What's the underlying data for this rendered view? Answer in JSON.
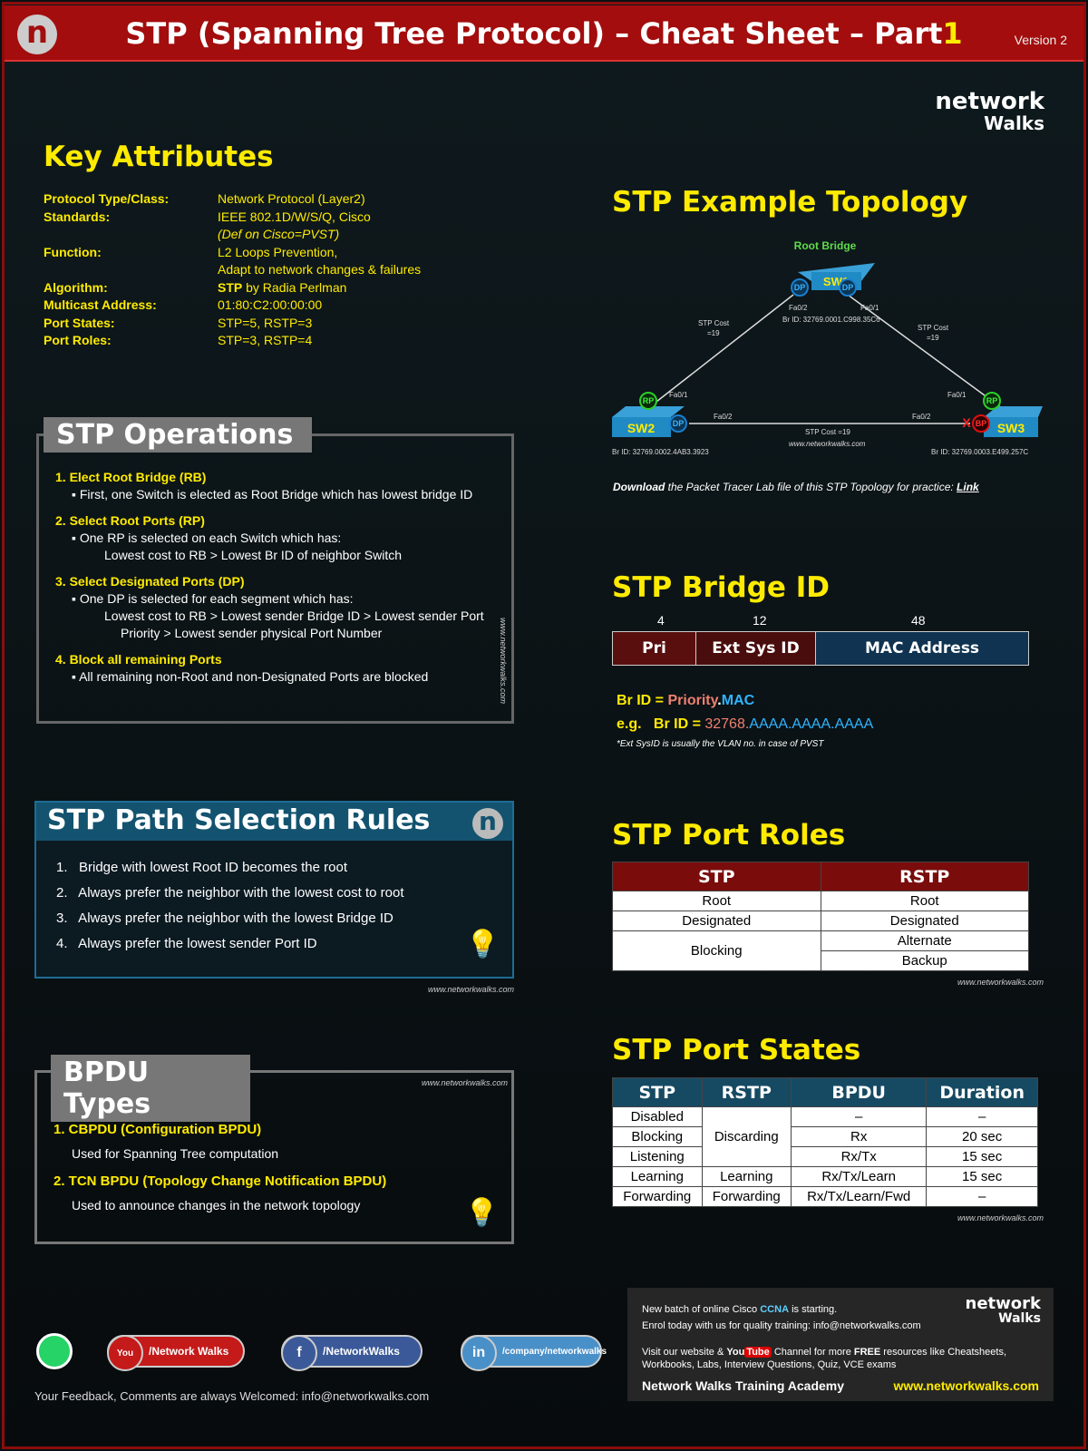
{
  "header": {
    "title": "STP (Spanning Tree Protocol) – Cheat Sheet – Part",
    "part": "1",
    "version": "Version 2",
    "logo": "n"
  },
  "brand": {
    "line1": "network",
    "line2": "Walks"
  },
  "key_attributes": {
    "title": "Key Attributes",
    "rows": [
      {
        "k": "Protocol Type/Class:",
        "v": "Network Protocol (Layer2)"
      },
      {
        "k": "Standards:",
        "v": "IEEE 802.1D/W/S/Q, Cisco"
      },
      {
        "k": "",
        "v": "(Def on Cisco=PVST)"
      },
      {
        "k": "Function:",
        "v": "L2 Loops Prevention,"
      },
      {
        "k": "",
        "v": "Adapt to network changes & failures"
      },
      {
        "k": "Algorithm:",
        "v_bold": "STP",
        "v": " by Radia Perlman"
      },
      {
        "k": "Multicast Address:",
        "v": "01:80:C2:00:00:00"
      },
      {
        "k": "Port States:",
        "v": "STP=5, RSTP=3"
      },
      {
        "k": "Port Roles:",
        "v": "STP=3, RSTP=4"
      }
    ]
  },
  "operations": {
    "title": "STP Operations",
    "watermark": "www.networkwalks.com",
    "items": [
      {
        "h": "1. Elect Root Bridge (RB)",
        "b": "▪ First, one Switch is elected as Root Bridge which has lowest bridge ID",
        "c": ""
      },
      {
        "h": "2. Select Root Ports (RP)",
        "b": "▪ One RP is selected on each Switch which has:",
        "c": "Lowest cost to RB > Lowest Br ID of neighbor Switch"
      },
      {
        "h": "3. Select Designated Ports (DP)",
        "b": "▪ One DP is selected for each segment which has:",
        "c": "Lowest cost to RB > Lowest sender Bridge ID > Lowest sender Port Priority > Lowest sender physical Port Number"
      },
      {
        "h": "4. Block all remaining Ports",
        "b": "▪ All remaining non-Root and non-Designated Ports are blocked",
        "c": ""
      }
    ]
  },
  "path_rules": {
    "title": "STP Path Selection Rules",
    "watermark": "www.networkwalks.com",
    "items": [
      "1.   Bridge with lowest Root ID becomes the root",
      "2.   Always prefer the neighbor with the lowest cost to root",
      "3.   Always prefer the neighbor with the lowest Bridge ID",
      "4.   Always prefer the lowest sender Port ID"
    ]
  },
  "bpdu": {
    "title": "BPDU Types",
    "watermark": "www.networkwalks.com",
    "items": [
      {
        "h": "1. CBPDU (Configuration BPDU)",
        "d": "Used for Spanning Tree computation"
      },
      {
        "h": "2. TCN BPDU (Topology Change Notification BPDU)",
        "d": "Used to announce changes in the network topology"
      }
    ]
  },
  "topology": {
    "title": "STP Example Topology",
    "root_label": "Root Bridge",
    "sw1": "SW1",
    "sw2": "SW2",
    "sw3": "SW3",
    "sw1_id": "Br ID: 32769.0001.C998.35C6",
    "sw2_id": "Br ID: 32769.0002.4AB3.3923",
    "sw3_id": "Br ID: 32769.0003.E499.257C",
    "fa01": "Fa0/1",
    "fa02": "Fa0/2",
    "cost": "STP Cost =19",
    "cost_a": "STP Cost",
    "cost_b": "=19",
    "dp": "DP",
    "rp": "RP",
    "bp": "BP",
    "x": "X",
    "watermark": "www.networkwalks.com",
    "download_bold": "Download",
    "download_text": " the Packet Tracer Lab file of this STP Topology for practice: ",
    "link": "Link"
  },
  "bridge_id": {
    "title": "STP Bridge ID",
    "bits": [
      "4",
      "12",
      "48"
    ],
    "fields": [
      "Pri",
      "Ext Sys ID",
      "MAC Address"
    ],
    "f1": "Br ID = ",
    "f1p": "Priority",
    "f1d": ".",
    "f1m": "MAC",
    "eg": "e.g.   Br ID = ",
    "egp": "32768.",
    "egm": "AAAA.AAAA.AAAA",
    "note": "*Ext SysID is usually the VLAN no. in case of PVST"
  },
  "port_roles": {
    "title": "STP Port Roles",
    "headers": [
      "STP",
      "RSTP"
    ],
    "rows": [
      [
        "Root",
        "Root"
      ],
      [
        "Designated",
        "Designated"
      ],
      [
        "Blocking",
        "Alternate"
      ],
      [
        "",
        "Backup"
      ]
    ],
    "watermark": "www.networkwalks.com"
  },
  "port_states": {
    "title": "STP Port States",
    "headers": [
      "STP",
      "RSTP",
      "BPDU",
      "Duration"
    ],
    "stp": [
      "Disabled",
      "Blocking",
      "Listening",
      "Learning",
      "Forwarding"
    ],
    "rstp": [
      "Discarding",
      "Learning",
      "Forwarding"
    ],
    "bpdu": [
      "–",
      "Rx",
      "Rx/Tx",
      "Rx/Tx/Learn",
      "Rx/Tx/Learn/Fwd"
    ],
    "duration": [
      "–",
      "20 sec",
      "15 sec",
      "15 sec",
      "–"
    ],
    "watermark": "www.networkwalks.com"
  },
  "social": {
    "youtube": "/Network Walks",
    "facebook": "/NetworkWalks",
    "linkedin": "/company/networkwalks",
    "feedback": "Your Feedback, Comments are always Welcomed: info@networkwalks.com"
  },
  "promo": {
    "l1a": "New batch of online Cisco ",
    "ccna": "CCNA",
    "l1b": " is starting.",
    "l2": "Enrol today with us for quality training: info@networkwalks.com",
    "l3a": "Visit our website & ",
    "you": "You",
    "tube": "Tube",
    "l3b": " Channel for more ",
    "free": "FREE",
    "l3c": " resources like Cheatsheets, Workbooks, Labs, Interview Questions, Quiz, VCE exams",
    "academy": "Network Walks Training Academy",
    "site": "www.networkwalks.com"
  }
}
